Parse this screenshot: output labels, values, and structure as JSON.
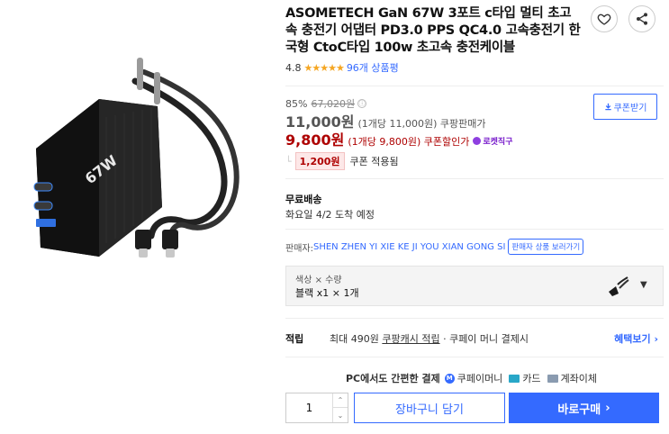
{
  "product": {
    "title": "ASOMETECH GaN 67W 3포트 c타입 멀티 초고속 충전기 어댑터 PD3.0 PPS QC4.0 고속충전기 한국형 CtoC타입 100w 초고속 충전케이블",
    "image_labels": {
      "charger_text": "67W"
    }
  },
  "icons": {
    "like": "heart-icon",
    "share": "share-icon",
    "info": "info-icon",
    "chevron": "chevron-down-icon"
  },
  "rating": {
    "score": "4.8",
    "stars": "★★★★★",
    "stars_value": 4.8,
    "reviews": "96개 상품평"
  },
  "price": {
    "discount": "85%",
    "original": "67,020원",
    "info_symbol": "ⓘ",
    "sale": "11,000원",
    "sale_note": "(1개당 11,000원) 쿠팡판매가",
    "coupon": "9,800원",
    "coupon_note": "(1개당 9,800원) 쿠폰할인가",
    "rocket_label": "로켓직구",
    "coupon_amount": "1,200원",
    "coupon_applied": "쿠폰 적용됨",
    "get_coupon": "쿠폰받기"
  },
  "shipping": {
    "label": "무료배송",
    "date": "화요일 4/2 도착 예정"
  },
  "seller": {
    "label": "판매자: ",
    "name": "SHEN ZHEN YI XIE KE JI YOU XIAN GONG SI",
    "more": "판매자 상품 보러가기"
  },
  "option": {
    "label": "색상 × 수량",
    "value": "블랙 x1 × 1개"
  },
  "points": {
    "label": "적립",
    "text_prefix": "최대 490원 ",
    "text_link": "쿠팡캐시 적립",
    "text_suffix": " · 쿠페이 머니 결제시",
    "benefit": "혜택보기 ›"
  },
  "payment": {
    "title": "PC에서도 간편한 결제",
    "methods": [
      {
        "label": "쿠페이머니",
        "icon_text": "M"
      },
      {
        "label": "카드"
      },
      {
        "label": "계좌이체"
      }
    ]
  },
  "purchase": {
    "quantity": "1",
    "cart": "장바구니 담기",
    "buy": "바로구매",
    "buy_chevron": "›"
  },
  "colors": {
    "accent": "#346aff",
    "sale_red": "#ae0000",
    "star": "#f5a623"
  }
}
